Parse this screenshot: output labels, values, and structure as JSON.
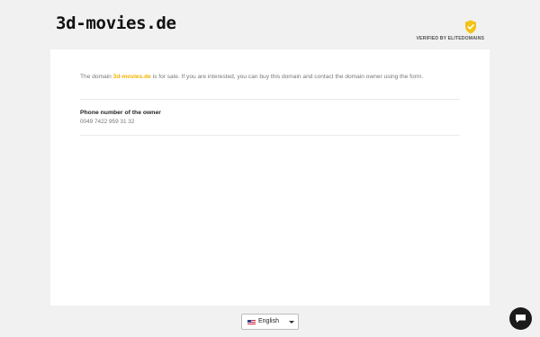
{
  "header": {
    "domain": "3d-movies.de",
    "verified_text": "VERIFIED BY ELITEDOMAINS",
    "shield_icon": "shield-check-icon",
    "shield_color": "#f2c318"
  },
  "main": {
    "intro_prefix": "The domain ",
    "intro_domain": "3d-movies.de",
    "intro_suffix": " is for sale. If you are interested, you can buy this domain and contact the domain owner using the form.",
    "phone_label": "Phone number of the owner",
    "phone_value": "0049 7422 959 31 32"
  },
  "footer": {
    "language_label": "English",
    "flag_icon": "us-flag-icon",
    "caret_icon": "chevron-down-icon"
  },
  "chat": {
    "icon": "chat-bubble-icon"
  },
  "colors": {
    "accent": "#f0b400",
    "background": "#f1f1f1",
    "card": "#ffffff"
  }
}
